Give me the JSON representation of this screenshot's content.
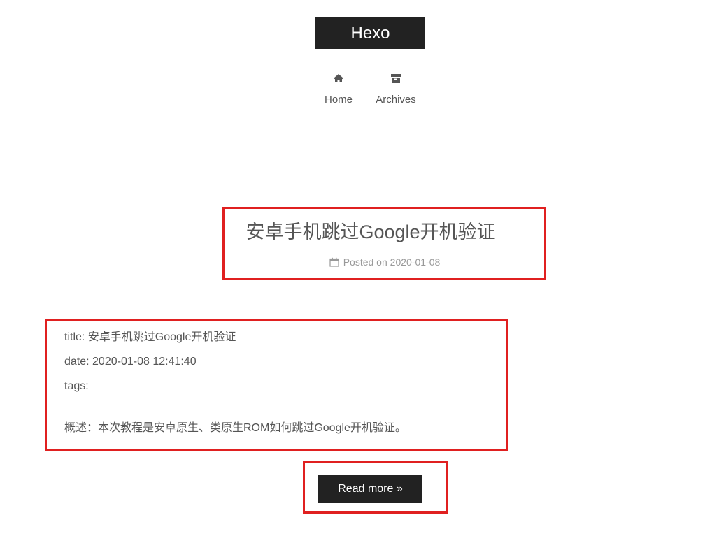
{
  "site": {
    "brand": "Hexo"
  },
  "nav": {
    "items": [
      {
        "label": "Home",
        "icon": "home-icon"
      },
      {
        "label": "Archives",
        "icon": "archive-icon"
      }
    ]
  },
  "post": {
    "title": "安卓手机跳过Google开机验证",
    "meta_prefix": "Posted on",
    "meta_date": "2020-01-08",
    "excerpt": {
      "title_line": "title: 安卓手机跳过Google开机验证",
      "date_line": "date: 2020-01-08 12:41:40",
      "tags_line": "tags:",
      "summary_line": "概述：本次教程是安卓原生、类原生ROM如何跳过Google开机验证。"
    },
    "read_more": "Read more »"
  },
  "colors": {
    "brand_bg": "#222222",
    "text": "#555555",
    "meta": "#999999",
    "annotation": "#e02020"
  }
}
